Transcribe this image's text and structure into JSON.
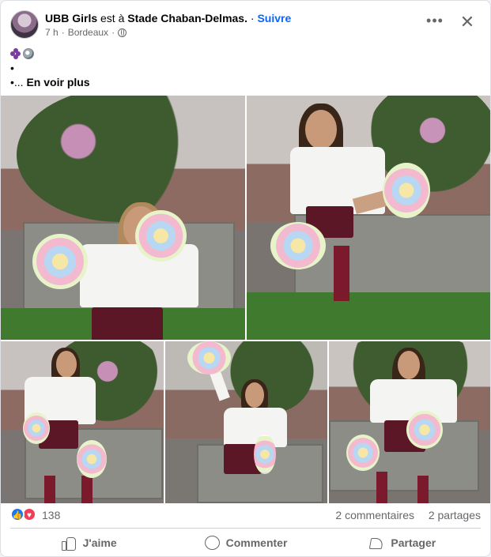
{
  "post": {
    "author": "UBB Girls",
    "connector": "est à",
    "location": "Stade Chaban-Delmas.",
    "separator": "·",
    "follow_label": "Suivre",
    "time": "7 h",
    "place": "Bordeaux",
    "dot": "·",
    "more_label": "•••",
    "close_label": "✕",
    "text": {
      "bullet1": "•",
      "bullet2_prefix": "•...",
      "see_more": "En voir plus"
    },
    "emojis": [
      "grapes-icon",
      "volleyball-icon"
    ]
  },
  "photos": [
    {
      "id": "photo-1",
      "alt": "cheerleader-photo"
    },
    {
      "id": "photo-2",
      "alt": "cheerleader-photo"
    },
    {
      "id": "photo-3",
      "alt": "cheerleader-photo"
    },
    {
      "id": "photo-4",
      "alt": "cheerleader-photo"
    },
    {
      "id": "photo-5",
      "alt": "cheerleader-photo"
    }
  ],
  "stats": {
    "reactions_count": "138",
    "comments": "2 commentaires",
    "shares": "2 partages"
  },
  "actions": {
    "like": "J'aime",
    "comment": "Commenter",
    "share": "Partager"
  },
  "colors": {
    "accent": "#0866ff",
    "like": "#1877f2",
    "love": "#f33e58",
    "muted": "#65676b"
  }
}
